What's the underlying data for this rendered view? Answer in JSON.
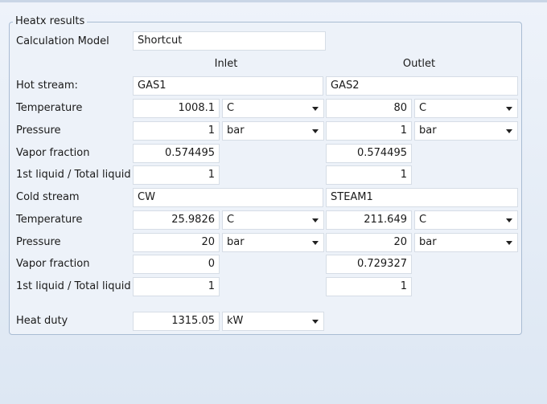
{
  "group_title": "Heatx results",
  "calc_model": {
    "label": "Calculation Model",
    "value": "Shortcut"
  },
  "columns": {
    "inlet": "Inlet",
    "outlet": "Outlet"
  },
  "hot": {
    "stream_label": "Hot stream:",
    "inlet_stream": "GAS1",
    "outlet_stream": "GAS2",
    "temperature": {
      "label": "Temperature",
      "inlet_value": "1008.1",
      "inlet_unit": "C",
      "outlet_value": "80",
      "outlet_unit": "C"
    },
    "pressure": {
      "label": "Pressure",
      "inlet_value": "1",
      "inlet_unit": "bar",
      "outlet_value": "1",
      "outlet_unit": "bar"
    },
    "vapor_fraction": {
      "label": "Vapor fraction",
      "inlet_value": "0.574495",
      "outlet_value": "0.574495"
    },
    "liquid_ratio": {
      "label": "1st liquid / Total liquid",
      "inlet_value": "1",
      "outlet_value": "1"
    }
  },
  "cold": {
    "stream_label": "Cold stream",
    "inlet_stream": "CW",
    "outlet_stream": "STEAM1",
    "temperature": {
      "label": "Temperature",
      "inlet_value": "25.9826",
      "inlet_unit": "C",
      "outlet_value": "211.649",
      "outlet_unit": "C"
    },
    "pressure": {
      "label": "Pressure",
      "inlet_value": "20",
      "inlet_unit": "bar",
      "outlet_value": "20",
      "outlet_unit": "bar"
    },
    "vapor_fraction": {
      "label": "Vapor fraction",
      "inlet_value": "0",
      "outlet_value": "0.729327"
    },
    "liquid_ratio": {
      "label": "1st liquid / Total liquid",
      "inlet_value": "1",
      "outlet_value": "1"
    }
  },
  "heat_duty": {
    "label": "Heat duty",
    "value": "1315.05",
    "unit": "kW"
  }
}
